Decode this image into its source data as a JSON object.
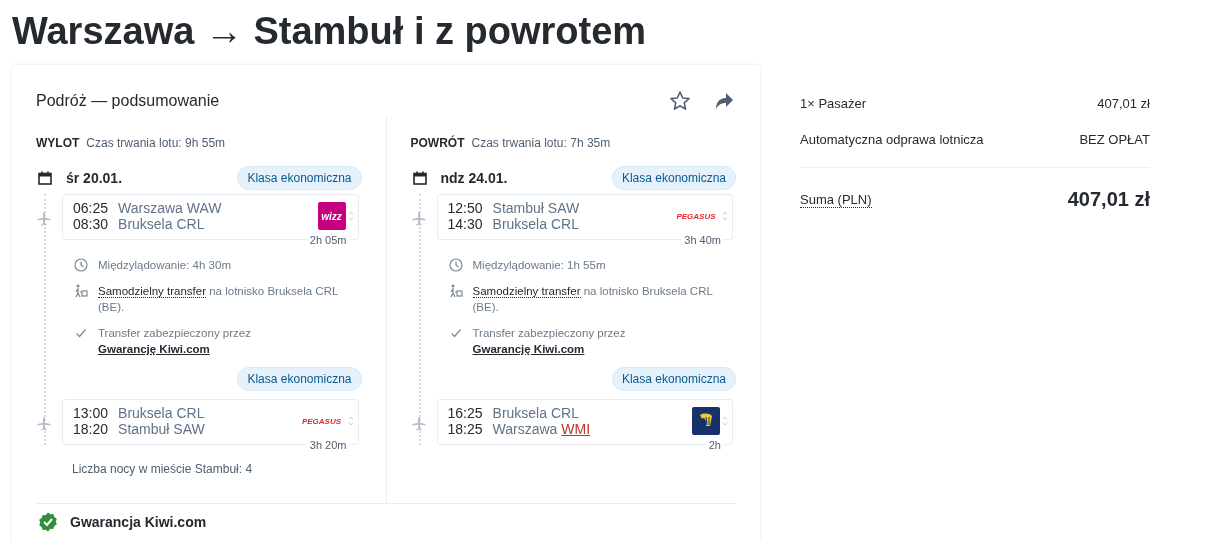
{
  "title": "Warszawa → Stambuł i z powrotem",
  "summary": {
    "title": "Podróż — podsumowanie",
    "legs": [
      {
        "label": "WYLOT",
        "duration": "Czas trwania lotu: 9h 55m",
        "date": "śr 20.01.",
        "items": [
          {
            "kind": "segment",
            "cabin": "Klasa ekonomiczna",
            "dep_time": "06:25",
            "dep_place": "Warszawa",
            "dep_code": "WAW",
            "arr_time": "08:30",
            "arr_place": "Bruksela",
            "arr_code": "CRL",
            "arr_code_warning": false,
            "airline": {
              "kind": "wizz",
              "text": "wizz"
            },
            "duration": "2h 05m"
          },
          {
            "kind": "layover",
            "stop": "Międzylądowanie: 4h 30m",
            "transfer_link": "Samodzielny transfer",
            "transfer_text": "na lotnisko Bruksela CRL (BE).",
            "guarantee_text": "Transfer zabezpieczony przez",
            "guarantee_link": "Gwarancję Kiwi.com"
          },
          {
            "kind": "segment",
            "cabin": "Klasa ekonomiczna",
            "dep_time": "13:00",
            "dep_place": "Bruksela",
            "dep_code": "CRL",
            "arr_time": "18:20",
            "arr_place": "Stambuł",
            "arr_code": "SAW",
            "arr_code_warning": false,
            "airline": {
              "kind": "pegasus",
              "text": "PEGASUS"
            },
            "duration": "3h 20m"
          }
        ],
        "nights": "Liczba nocy w mieście Stambuł: 4"
      },
      {
        "label": "POWRÓT",
        "duration": "Czas trwania lotu: 7h 35m",
        "date": "ndz 24.01.",
        "items": [
          {
            "kind": "segment",
            "cabin": "Klasa ekonomiczna",
            "dep_time": "12:50",
            "dep_place": "Stambuł",
            "dep_code": "SAW",
            "arr_time": "14:30",
            "arr_place": "Bruksela",
            "arr_code": "CRL",
            "arr_code_warning": false,
            "airline": {
              "kind": "pegasus",
              "text": "PEGASUS"
            },
            "duration": "3h 40m"
          },
          {
            "kind": "layover",
            "stop": "Międzylądowanie: 1h 55m",
            "transfer_link": "Samodzielny transfer",
            "transfer_text": "na lotnisko Bruksela CRL (BE).",
            "guarantee_text": "Transfer zabezpieczony przez",
            "guarantee_link": "Gwarancję Kiwi.com"
          },
          {
            "kind": "segment",
            "cabin": "Klasa ekonomiczna",
            "dep_time": "16:25",
            "dep_place": "Bruksela",
            "dep_code": "CRL",
            "arr_time": "18:25",
            "arr_place": "Warszawa",
            "arr_code": "WMI",
            "arr_code_warning": true,
            "airline": {
              "kind": "ryanair"
            },
            "duration": "2h"
          }
        ]
      }
    ],
    "guarantee": "Gwarancja Kiwi.com"
  },
  "price": {
    "rows": [
      {
        "label": "1× Pasażer",
        "value": "407,01 zł"
      },
      {
        "label": "Automatyczna odprawa lotnicza",
        "value": "BEZ OPŁAT"
      }
    ],
    "total_label": "Suma (PLN)",
    "total": "407,01 zł"
  }
}
